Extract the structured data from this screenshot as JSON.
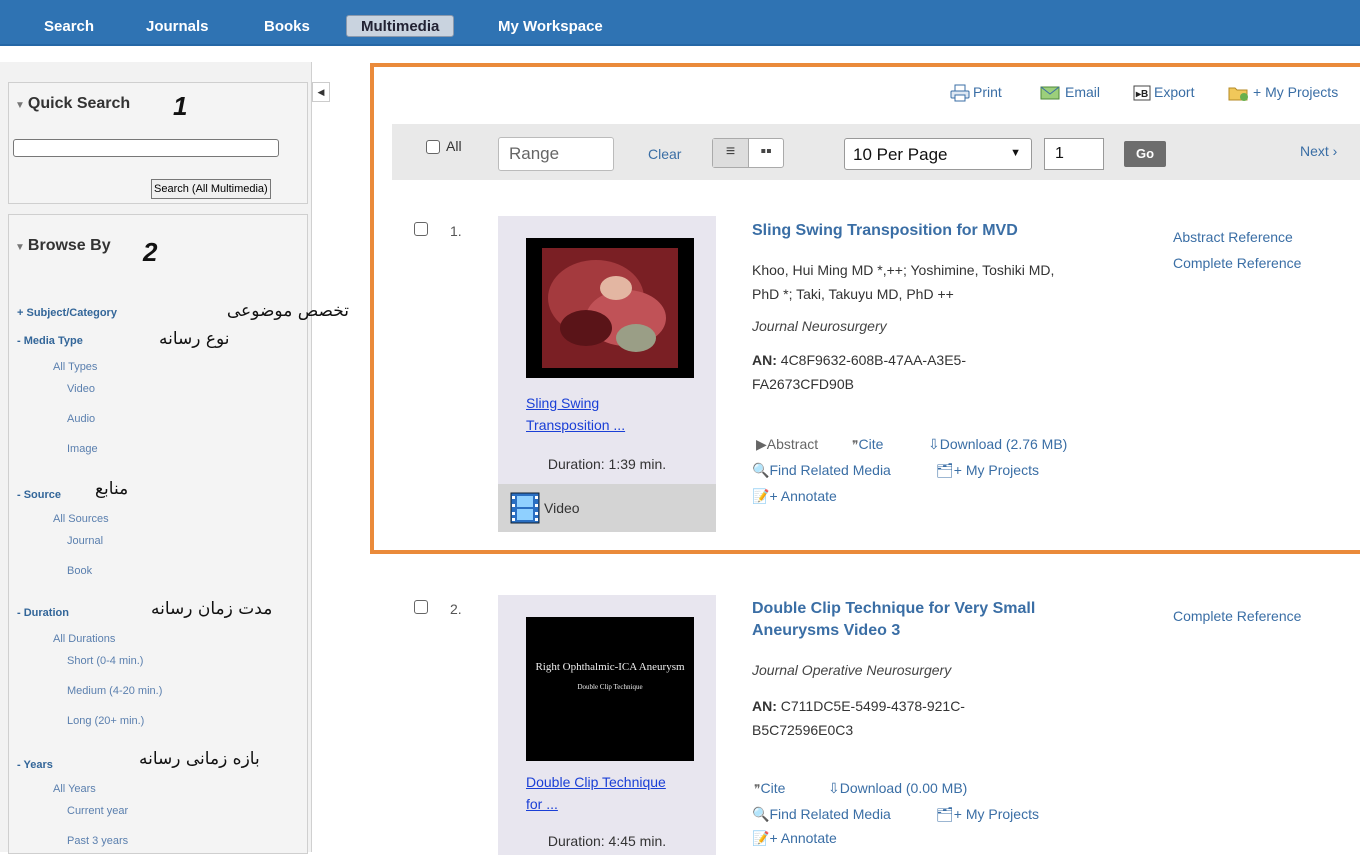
{
  "nav": {
    "items": [
      "Search",
      "Journals",
      "Books",
      "Multimedia",
      "My Workspace"
    ],
    "active": "Multimedia"
  },
  "quick_search": {
    "title": "Quick Search",
    "number": "1",
    "value": "",
    "button": "Search (All Multimedia)"
  },
  "browse": {
    "title": "Browse By",
    "number": "2",
    "subject": "+ Subject/Category",
    "subject_fa": "تخصص موضوعی",
    "media_type": "- Media Type",
    "media_type_fa": "نوع رسانه",
    "media_items": [
      "All Types",
      "Video",
      "Audio",
      "Image"
    ],
    "source": "- Source",
    "source_fa": "منابع",
    "source_items": [
      "All Sources",
      "Journal",
      "Book"
    ],
    "duration": "- Duration",
    "duration_fa": "مدت زمان رسانه",
    "duration_items": [
      "All Durations",
      "Short (0-4 min.)",
      "Medium (4-20 min.)",
      "Long (20+ min.)"
    ],
    "years": "- Years",
    "years_fa": "بازه زمانی رسانه",
    "years_items": [
      "All Years",
      "Current year",
      "Past 3 years"
    ]
  },
  "tools": {
    "print": "Print",
    "email": "Email",
    "export": "Export",
    "projects": "+ My Projects"
  },
  "toolbar": {
    "all": "All",
    "range_placeholder": "Range",
    "clear": "Clear",
    "per_page": "10 Per Page",
    "page": "1",
    "go": "Go",
    "next": "Next ›"
  },
  "results": [
    {
      "num": "1.",
      "thumb_overlay": "",
      "thumb_link": [
        "Sling Swing",
        "Transposition ..."
      ],
      "duration": "Duration: 1:39 min.",
      "type": "Video",
      "title": "Sling Swing Transposition for MVD",
      "authors": [
        "Khoo, Hui Ming MD *,++; Yoshimine, Toshiki MD,",
        "PhD *; Taki, Takuyu MD, PhD ++"
      ],
      "journal": "Journal Neurosurgery",
      "an_label": "AN:",
      "an_value": [
        "4C8F9632-608B-47AA-A3E5-",
        "FA2673CFD90B"
      ],
      "refs": [
        "Abstract Reference",
        "Complete Reference"
      ],
      "actions": {
        "abstract": "Abstract",
        "cite": "Cite",
        "download": "Download (2.76 MB)",
        "related": "Find Related Media",
        "projects": "+ My Projects",
        "annotate": "+ Annotate"
      }
    },
    {
      "num": "2.",
      "thumb_overlay": [
        "Right Ophthalmic-ICA Aneurysm",
        "Double Clip Technique"
      ],
      "thumb_link": [
        "Double Clip Technique",
        "for ..."
      ],
      "duration": "Duration: 4:45 min.",
      "title": [
        "Double Clip Technique for Very Small",
        "Aneurysms Video 3"
      ],
      "journal": "Journal Operative Neurosurgery",
      "an_label": "AN:",
      "an_value": [
        "C711DC5E-5499-4378-921C-",
        "B5C72596E0C3"
      ],
      "refs": [
        "Complete Reference"
      ],
      "actions": {
        "cite": "Cite",
        "download": "Download (0.00 MB)",
        "related": "Find Related Media",
        "projects": "+ My Projects",
        "annotate": "+ Annotate"
      }
    }
  ]
}
